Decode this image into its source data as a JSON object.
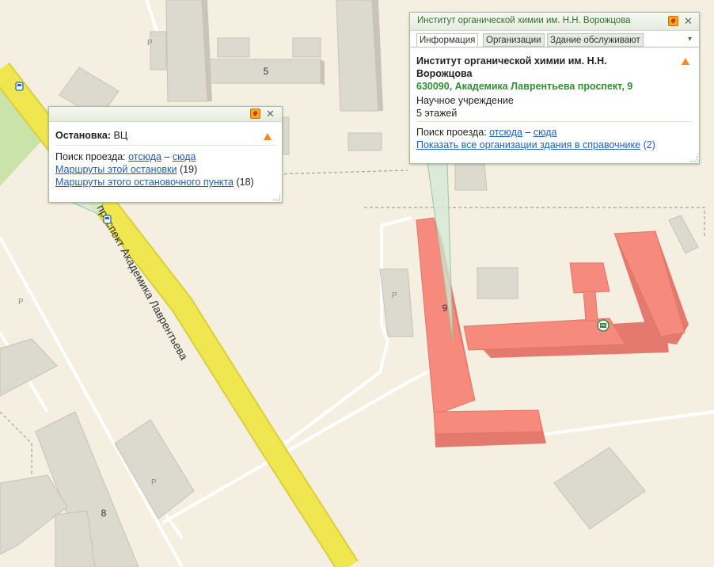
{
  "map": {
    "street_name": "проспект Академика Лаврентьева",
    "parking_label": "P",
    "house_numbers": {
      "top": "5",
      "institute": "9",
      "bottom_left": "8"
    },
    "colors": {
      "background": "#f4efe0",
      "road": "#f0e64f",
      "highlight": "#f58a7d",
      "building": "#dcd9ce",
      "green": "#c9e3a8"
    }
  },
  "stop_popup": {
    "title_label": "Остановка:",
    "title_value": "ВЦ",
    "route_search_label": "Поиск проезда:",
    "from_here": "отсюда",
    "dash": "–",
    "to_here": "сюда",
    "routes_stop_link": "Маршруты этой остановки",
    "routes_stop_count": "(19)",
    "routes_point_link": "Маршруты этого остановочного пункта",
    "routes_point_count": "(18)"
  },
  "org_popup": {
    "header_title": "Институт органической химии им. Н.Н. Ворожцова",
    "tabs": [
      "Информация",
      "Организации",
      "Здание обслуживают"
    ],
    "name_line1": "Институт органической химии им. Н.Н.",
    "name_line2": "Ворожцова",
    "address": "630090, Академика Лаврентьева проспект, 9",
    "category": "Научное учреждение",
    "floors": "5 этажей",
    "route_search_label": "Поиск проезда:",
    "from_here": "отсюда",
    "dash": "–",
    "to_here": "сюда",
    "show_all_link": "Показать все организации здания в справочнике",
    "show_all_count": "(2)"
  }
}
